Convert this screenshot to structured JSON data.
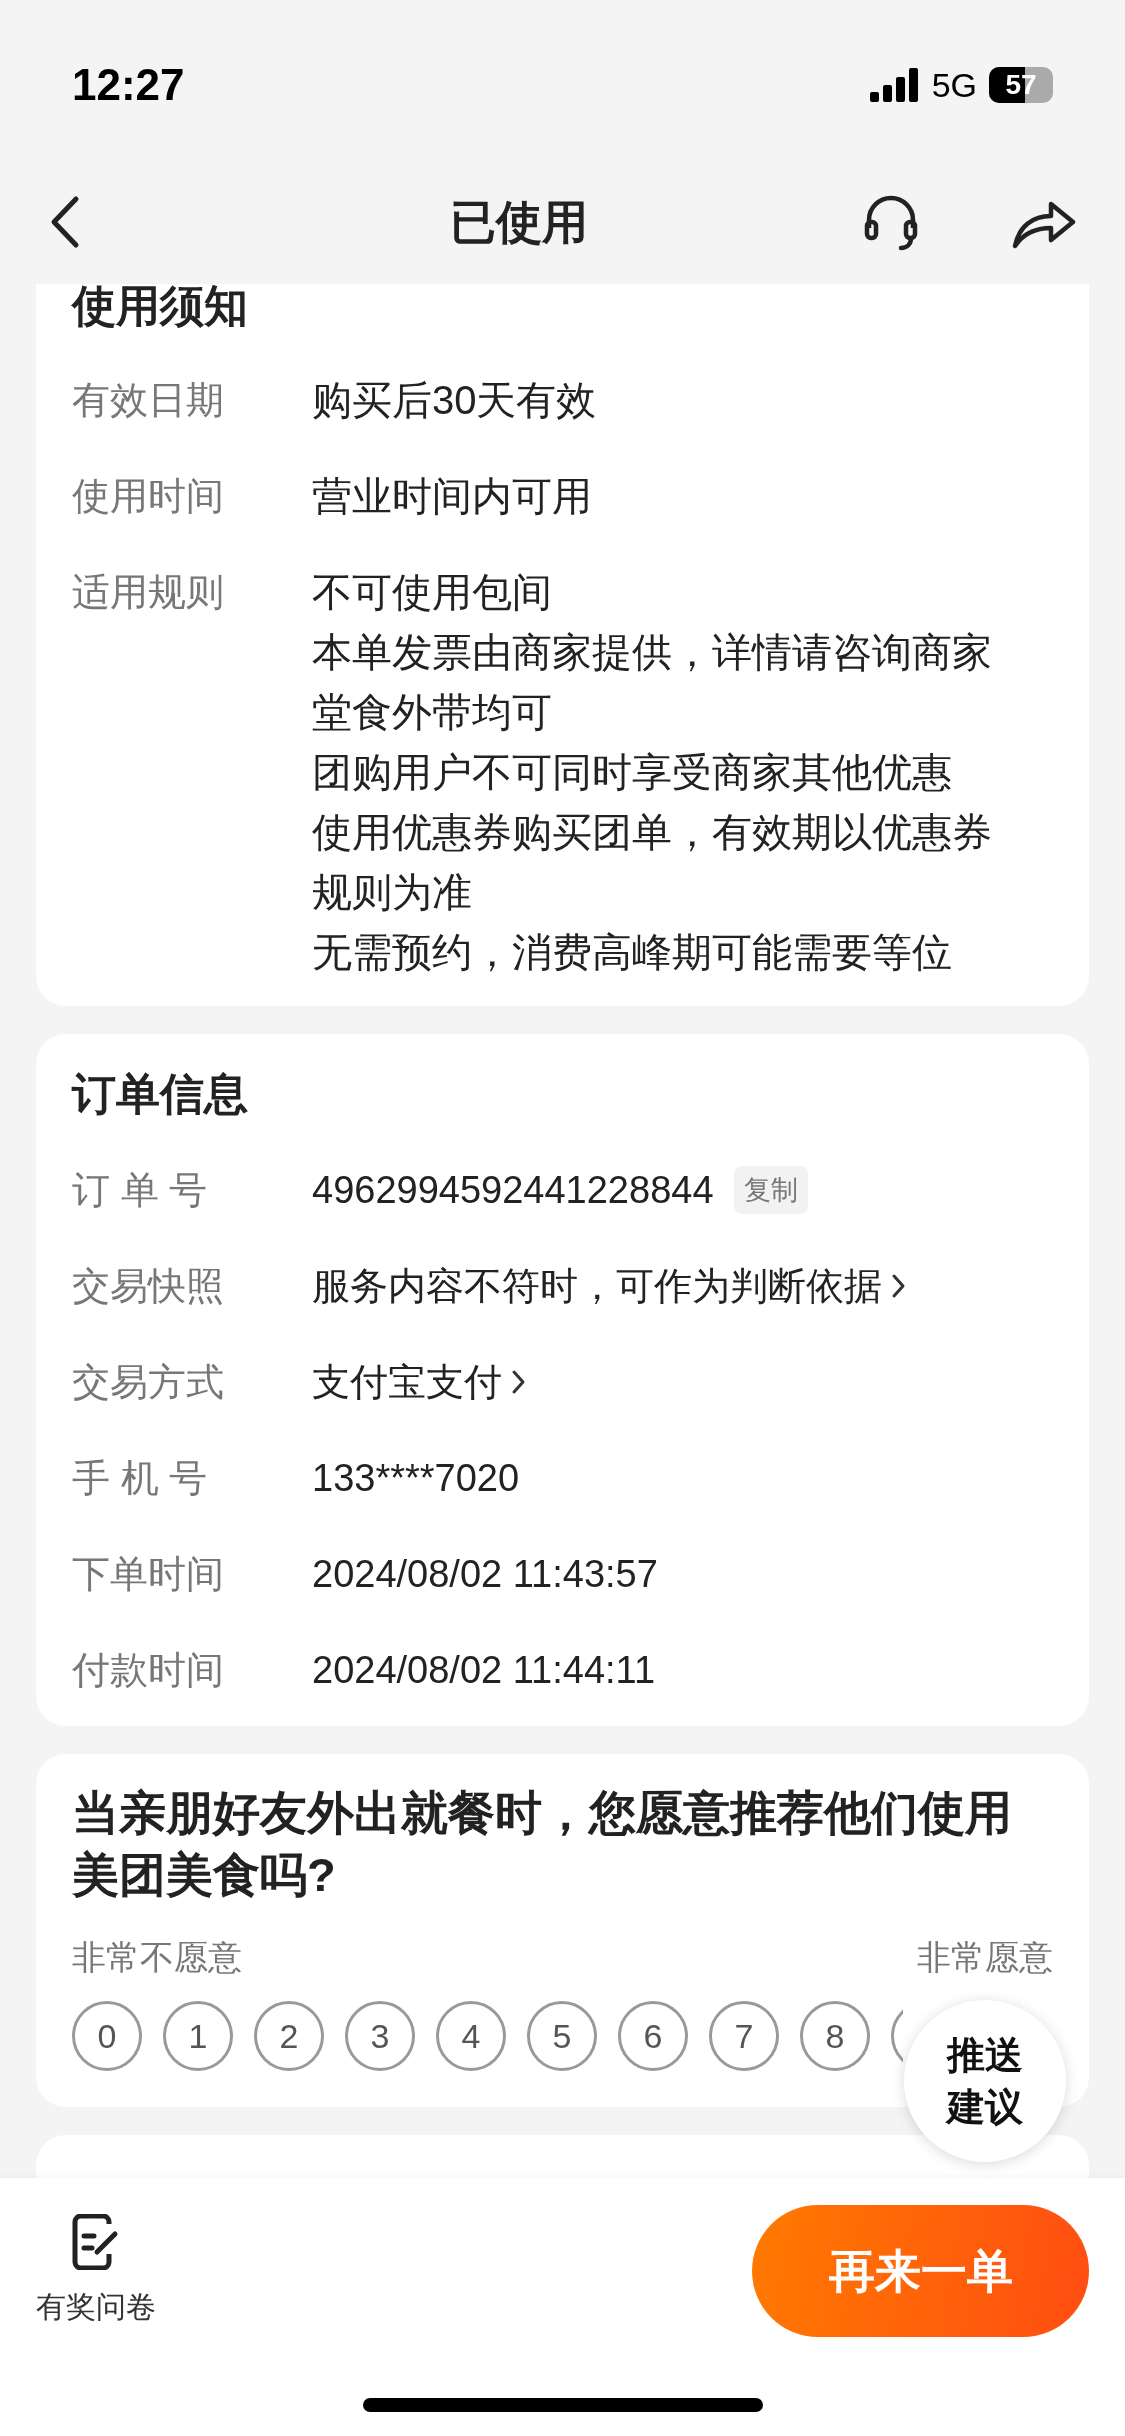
{
  "status_bar": {
    "time": "12:27",
    "network": "5G",
    "battery": "57"
  },
  "nav": {
    "title": "已使用"
  },
  "usage_notice": {
    "title": "使用须知",
    "rows": [
      {
        "label": "有效日期",
        "lines": [
          "购买后30天有效"
        ]
      },
      {
        "label": "使用时间",
        "lines": [
          "营业时间内可用"
        ]
      },
      {
        "label": "适用规则",
        "lines": [
          "不可使用包间",
          "本单发票由商家提供，详情请咨询商家",
          "堂食外带均可",
          "团购用户不可同时享受商家其他优惠",
          "使用优惠券购买团单，有效期以优惠券规则为准",
          "无需预约，消费高峰期可能需要等位"
        ]
      }
    ]
  },
  "order_info": {
    "title": "订单信息",
    "rows": [
      {
        "label": "订 单 号",
        "value": "4962994592441228844",
        "kind": "copy",
        "action": "复制"
      },
      {
        "label": "交易快照",
        "value": "服务内容不符时，可作为判断依据",
        "kind": "link"
      },
      {
        "label": "交易方式",
        "value": "支付宝支付",
        "kind": "link"
      },
      {
        "label": "手 机 号",
        "value": "133****7020",
        "kind": "plain"
      },
      {
        "label": "下单时间",
        "value": "2024/08/02 11:43:57",
        "kind": "plain"
      },
      {
        "label": "付款时间",
        "value": "2024/08/02 11:44:11",
        "kind": "plain"
      }
    ]
  },
  "survey": {
    "question": "当亲朋好友外出就餐时，您愿意推荐他们使用美团美食吗?",
    "low_label": "非常不愿意",
    "high_label": "非常愿意",
    "options": [
      "0",
      "1",
      "2",
      "3",
      "4",
      "5",
      "6",
      "7",
      "8"
    ]
  },
  "floating_button": {
    "lines": [
      "推送",
      "建议"
    ]
  },
  "bottom_bar": {
    "survey_link": "有奖问卷",
    "primary_button": "再来一单"
  }
}
